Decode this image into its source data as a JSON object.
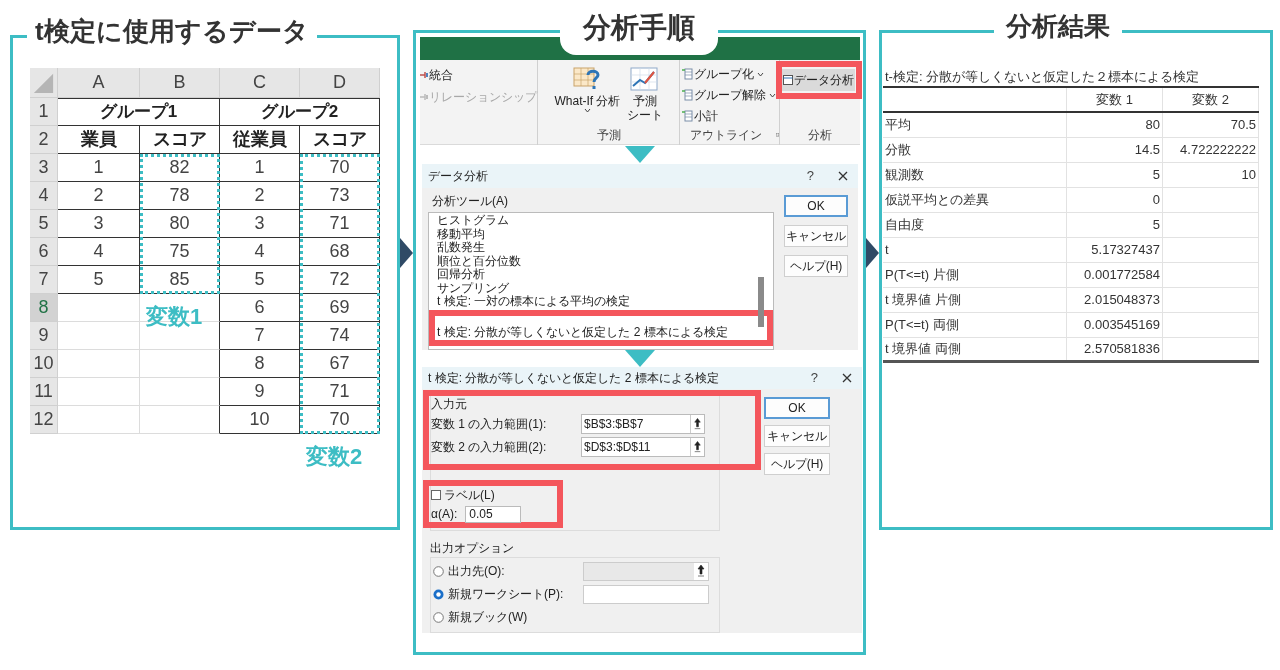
{
  "data_panel": {
    "title": "t検定に使用するデータ",
    "column_headers": [
      "A",
      "B",
      "C",
      "D"
    ],
    "row_numbers": [
      {
        "label": "1",
        "selected": false
      },
      {
        "label": "2",
        "selected": false
      },
      {
        "label": "3",
        "selected": false
      },
      {
        "label": "4",
        "selected": false
      },
      {
        "label": "5",
        "selected": false
      },
      {
        "label": "6",
        "selected": false
      },
      {
        "label": "7",
        "selected": false
      },
      {
        "label": "8",
        "selected": true
      },
      {
        "label": "9",
        "selected": false
      },
      {
        "label": "10",
        "selected": false
      },
      {
        "label": "11",
        "selected": false
      },
      {
        "label": "12",
        "selected": false
      }
    ],
    "groups": [
      {
        "title": "グループ1",
        "columns": [
          "業員",
          "スコア"
        ],
        "rows": [
          [
            "1",
            "82"
          ],
          [
            "2",
            "78"
          ],
          [
            "3",
            "80"
          ],
          [
            "4",
            "75"
          ],
          [
            "5",
            "85"
          ]
        ],
        "variable_label": "変数1"
      },
      {
        "title": "グループ2",
        "columns": [
          "従業員",
          "スコア"
        ],
        "rows": [
          [
            "1",
            "70"
          ],
          [
            "2",
            "73"
          ],
          [
            "3",
            "71"
          ],
          [
            "4",
            "68"
          ],
          [
            "5",
            "72"
          ],
          [
            "6",
            "69"
          ],
          [
            "7",
            "74"
          ],
          [
            "8",
            "67"
          ],
          [
            "9",
            "71"
          ],
          [
            "10",
            "70"
          ]
        ],
        "variable_label": "変数2"
      }
    ]
  },
  "steps_panel": {
    "title": "分析手順",
    "ribbon": {
      "data_tools": [
        {
          "label": "統合",
          "disabled": false
        },
        {
          "label": "リレーションシップ",
          "disabled": true
        }
      ],
      "forecast_group": {
        "label": "予測",
        "buttons": [
          {
            "lines": [
              "What-If 分析"
            ],
            "dropdown": true
          },
          {
            "lines": [
              "予測",
              "シート"
            ],
            "dropdown": false
          }
        ]
      },
      "outline_group": {
        "label": "アウトライン",
        "items": [
          {
            "label": "グループ化",
            "dropdown": true
          },
          {
            "label": "グループ解除",
            "dropdown": true
          },
          {
            "label": "小計",
            "dropdown": false
          }
        ]
      },
      "analysis_group": {
        "label": "分析",
        "button": "データ分析"
      }
    },
    "analysis_dialog": {
      "title": "データ分析",
      "help": "?",
      "list_label": "分析ツール(A)",
      "items": [
        {
          "label": "ヒストグラム",
          "selected": false
        },
        {
          "label": "移動平均",
          "selected": false
        },
        {
          "label": "乱数発生",
          "selected": false
        },
        {
          "label": "順位と百分位数",
          "selected": false
        },
        {
          "label": "回帰分析",
          "selected": false
        },
        {
          "label": "サンプリング",
          "selected": false
        },
        {
          "label": "t 検定:  一対の標本による平均の検定",
          "selected": false
        },
        {
          "label": "t 検定:  分散が等しくないと仮定した 2 標本による検定",
          "selected": true
        }
      ],
      "buttons": [
        "OK",
        "キャンセル",
        "ヘルプ(H)"
      ]
    },
    "ttest_dialog": {
      "title": "t 検定:  分散が等しくないと仮定した 2 標本による検定",
      "help": "?",
      "input_group": "入力元",
      "fields": [
        {
          "label": "変数 1 の入力範囲(1):",
          "value": "$B$3:$B$7"
        },
        {
          "label": "変数 2 の入力範囲(2):",
          "value": "$D$3:$D$11"
        }
      ],
      "label_checkbox": {
        "label": "ラベル(L)",
        "checked": false
      },
      "alpha": {
        "label": "α(A):",
        "value": "0.05"
      },
      "output_group": "出力オプション",
      "outputs": [
        {
          "label": "出力先(O):",
          "selected": false,
          "input": {
            "disabled": true
          }
        },
        {
          "label": "新規ワークシート(P):",
          "selected": true,
          "input": {
            "disabled": false
          }
        },
        {
          "label": "新規ブック(W)",
          "selected": false
        }
      ],
      "buttons": [
        "OK",
        "キャンセル",
        "ヘルプ(H)"
      ]
    }
  },
  "results_panel": {
    "title": "分析結果",
    "table_title": "t-検定: 分散が等しくないと仮定した２標本による検定",
    "columns": [
      "変数 1",
      "変数 2"
    ],
    "rows": [
      {
        "label": "平均",
        "values": [
          "80",
          "70.5"
        ]
      },
      {
        "label": "分散",
        "values": [
          "14.5",
          "4.722222222"
        ]
      },
      {
        "label": "観測数",
        "values": [
          "5",
          "10"
        ]
      },
      {
        "label": "仮説平均との差異",
        "values": [
          "0"
        ]
      },
      {
        "label": "自由度",
        "values": [
          "5"
        ]
      },
      {
        "label": "t",
        "values": [
          "5.17327437"
        ]
      },
      {
        "label": "P(T<=t) 片側",
        "values": [
          "0.001772584"
        ]
      },
      {
        "label": "t 境界値 片側",
        "values": [
          "2.015048373"
        ]
      },
      {
        "label": "P(T<=t) 両側",
        "values": [
          "0.003545169"
        ]
      },
      {
        "label": "t 境界値 両側",
        "values": [
          "2.570581836"
        ]
      }
    ]
  }
}
